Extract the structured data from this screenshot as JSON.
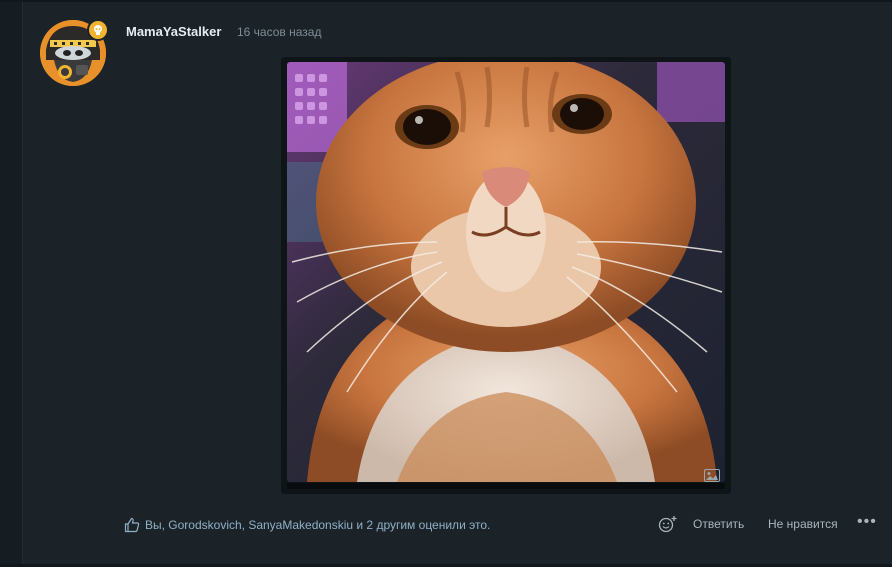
{
  "post": {
    "author": "MamaYaStalker",
    "timestamp": "16 часов назад"
  },
  "icons": {
    "badge": "skull-badge-icon",
    "image": "image-icon",
    "like": "thumbs-up-icon",
    "react": "add-reaction-icon",
    "more": "more-dots-icon"
  },
  "footer": {
    "likes_text": "Вы, Gorodskovich, SanyaMakedonskiu и 2 другим оценили это.",
    "reply_label": "Ответить",
    "dislike_label": "Не нравится",
    "more_label": "•••"
  },
  "colors": {
    "background": "#1b2329",
    "accent": "#8fb0c4",
    "badge": "#f2b32e"
  }
}
